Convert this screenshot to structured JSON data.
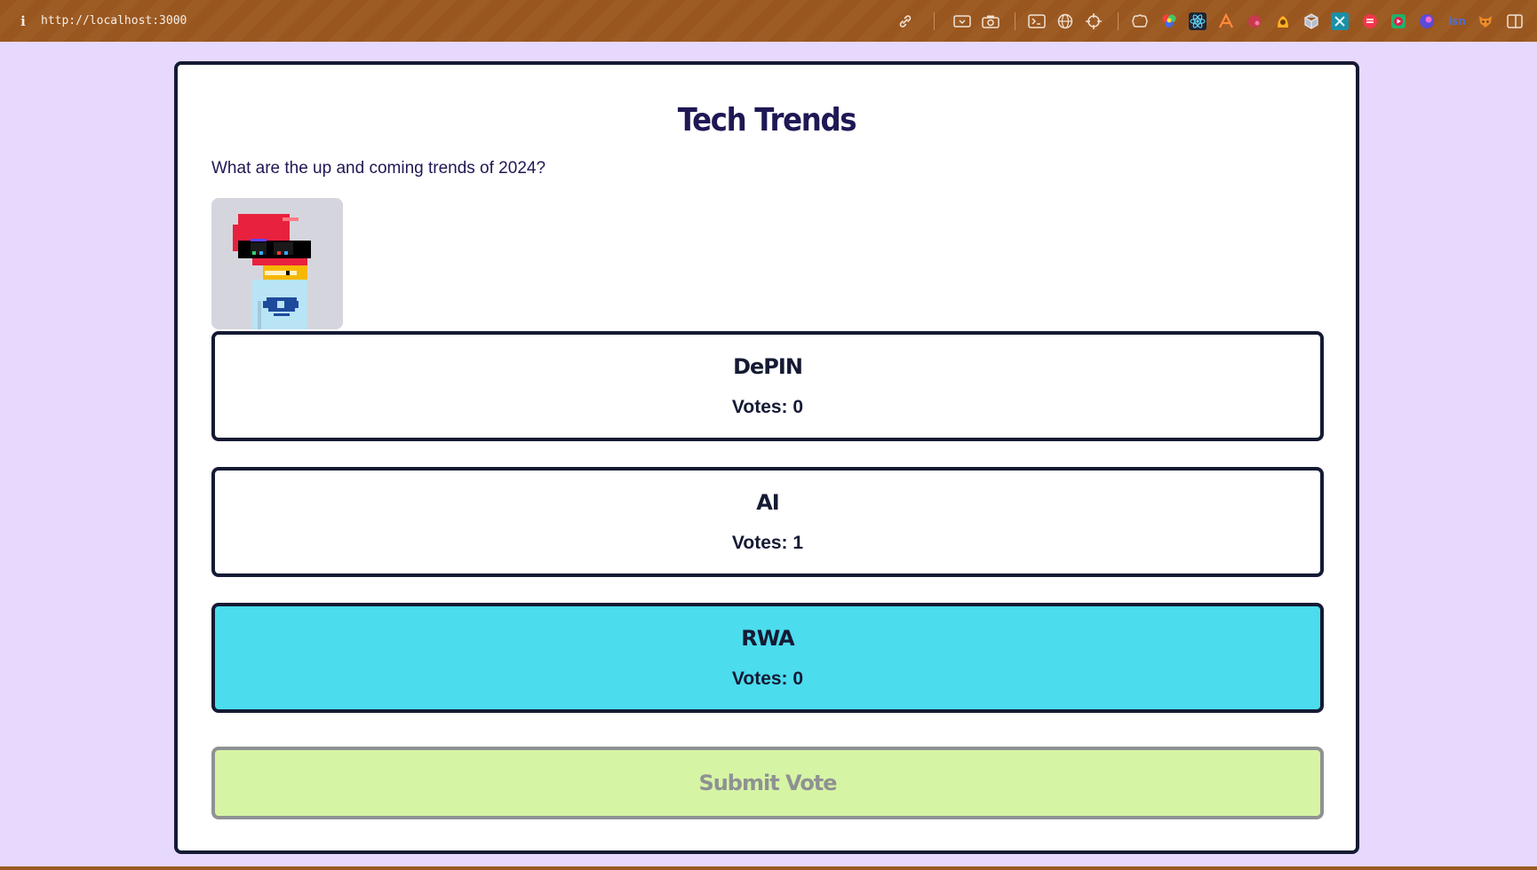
{
  "browser": {
    "url": "http://localhost:3000",
    "toolbar_icons": [
      "link-icon",
      "screenshot-icon",
      "camera-icon",
      "terminal-icon",
      "globe-icon",
      "crosshair-icon",
      "extension-icon",
      "color-picker-icon",
      "react-icon",
      "ext-a-icon",
      "ext-b-icon",
      "ext-c-icon",
      "cube-icon",
      "ext-d-icon",
      "ext-e-icon",
      "ext-f-icon",
      "ext-g-icon",
      "ext-h-icon",
      "ext-i-icon",
      "sidebar-toggle-icon"
    ]
  },
  "poll": {
    "title": "Tech Trends",
    "question": "What are the up and coming trends of 2024?",
    "options": [
      {
        "label": "DePIN",
        "votes": "Votes: 0",
        "selected": false
      },
      {
        "label": "AI",
        "votes": "Votes: 1",
        "selected": false
      },
      {
        "label": "RWA",
        "votes": "Votes: 0",
        "selected": true
      }
    ],
    "submit_label": "Submit Vote",
    "submit_enabled": false
  },
  "colors": {
    "page_background": "#e7d8fd",
    "selected_option": "#4bdcee",
    "submit_background": "#d6f5a4",
    "border": "#151a33",
    "title": "#1e1854"
  }
}
